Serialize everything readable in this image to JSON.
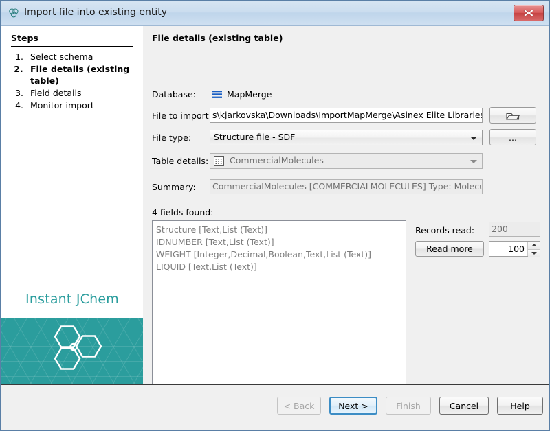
{
  "window": {
    "title": "Import file into existing entity",
    "title_icon": "molecule-icon",
    "close_icon": "close-icon"
  },
  "steps": {
    "heading": "Steps",
    "items": [
      {
        "label": "Select schema",
        "active": false
      },
      {
        "label": "File details (existing table)",
        "active": true
      },
      {
        "label": "Field details",
        "active": false
      },
      {
        "label": "Monitor import",
        "active": false
      }
    ]
  },
  "branding": {
    "wordmark": "Instant JChem",
    "logo_icon": "hexagon-molecule-logo",
    "accent_color": "#2b9d9d"
  },
  "main": {
    "heading": "File details (existing table)",
    "fields": {
      "database": {
        "label": "Database:",
        "icon": "database-lines-icon",
        "value": "MapMerge"
      },
      "file_to_import": {
        "label": "File to import:",
        "value": "s\\kjarkovska\\Downloads\\ImportMapMerge\\Asinex Elite Libraries.sdf",
        "browse_icon": "folder-open-icon"
      },
      "file_type": {
        "label": "File type:",
        "value": "Structure file - SDF",
        "more_button_label": "...",
        "arrow_icon": "chevron-down-icon"
      },
      "table_details": {
        "label": "Table details:",
        "icon": "table-grid-icon",
        "value": "CommercialMolecules",
        "arrow_icon": "chevron-down-icon"
      },
      "summary": {
        "label": "Summary:",
        "value": "CommercialMolecules [COMMERCIALMOLECULES] Type: Molecules"
      }
    },
    "fields_found": {
      "caption": "4 fields found:",
      "rows": [
        "Structure [Text,List (Text)]",
        "IDNUMBER [Text,List (Text)]",
        "WEIGHT [Integer,Decimal,Boolean,Text,List (Text)]",
        "LIQUID [Text,List (Text)]"
      ]
    },
    "records": {
      "label": "Records read:",
      "value": "200",
      "read_more_label": "Read more",
      "step_value": "100",
      "up_icon": "spinner-up-icon",
      "down_icon": "spinner-down-icon"
    }
  },
  "footer": {
    "back": {
      "label": "< Back",
      "enabled": false
    },
    "next": {
      "label": "Next >",
      "enabled": true,
      "default": true
    },
    "finish": {
      "label": "Finish",
      "enabled": false
    },
    "cancel": {
      "label": "Cancel",
      "enabled": true
    },
    "help": {
      "label": "Help",
      "enabled": true
    }
  }
}
